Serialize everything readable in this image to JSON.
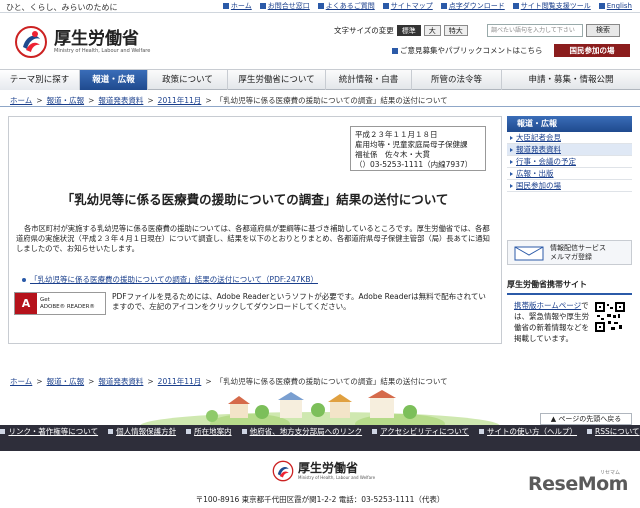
{
  "topbar": {
    "tagline": "ひと、くらし、みらいのために",
    "links": [
      "ホーム",
      "お問合せ窓口",
      "よくあるご質問",
      "サイトマップ",
      "点字ダウンロード",
      "サイト閲覧支援ツール",
      "English"
    ]
  },
  "header": {
    "logo_title": "厚生労働省",
    "logo_sub": "Ministry of Health, Labour and Welfare",
    "fontsize_label": "文字サイズの変更",
    "fontsize_options": [
      "標準",
      "大",
      "特大"
    ],
    "search_placeholder": "調べたい語句を入力して下さい",
    "search_button": "検索",
    "opinion_link": "ご意見募集やパブリックコメントはこちら",
    "kokumin_button": "国民参加の場"
  },
  "nav": {
    "items": [
      "テーマ別に探す",
      "報道・広報",
      "政策について",
      "厚生労働省について",
      "統計情報・白書",
      "所管の法令等",
      "申請・募集・情報公開"
    ]
  },
  "breadcrumb": {
    "items": [
      "ホーム",
      "報道・広報",
      "報道発表資料",
      "2011年11月"
    ],
    "current": "「乳幼児等に係る医療費の援助についての調査」結果の送付について"
  },
  "sender": {
    "lines": [
      "平成２３年１１月１８日",
      "雇用均等・児童家庭局母子保健課",
      "福祉係　佐々木・大貫",
      "（）03-5253-1111（内線7937）"
    ]
  },
  "article": {
    "title": "「乳幼児等に係る医療費の援助についての調査」結果の送付について",
    "body": "各市区町村が実施する乳幼児等に係る医療費の援助については、各都道府県が要綱等に基づき補助しているところです。厚生労働省では、各都道府県の実施状況（平成２３年４月１日現在）について調査し、結果を以下のとおりとりまとめ、各都道府県母子保健主管部（局）長あてに通知しましたので、お知らせいたします。",
    "pdf_link": "「乳幼児等に係る医療費の援助についての調査」結果の送付について（PDF:247KB）",
    "adobe_label_1": "Get",
    "adobe_label_2": "ADOBE® READER®",
    "adobe_note": "PDFファイルを見るためには、Adobe Readerというソフトが必要です。Adobe Readerは無料で配布されていますので、左記のアイコンをクリックしてダウンロードしてください。"
  },
  "sidebar": {
    "heading": "報道・広報",
    "items": [
      "大臣記者会見",
      "報道発表資料",
      "行事・会議の予定",
      "広報・出版",
      "国民参加の場"
    ],
    "mail_line1": "情報配信サービス",
    "mail_line2": "メルマガ登録",
    "mobile_title": "厚生労働省携帯サイト",
    "mobile_link": "携帯版ホームページ",
    "mobile_text": "では、緊急情報や厚生労働省の新着情報などを掲載しています。"
  },
  "pagetop": "ページの先頭へ戻る",
  "footer": {
    "links": [
      "リンク・著作権等について",
      "個人情報保護方針",
      "所在地案内",
      "他府省、地方支分部局へのリンク",
      "アクセシビリティについて",
      "サイトの使い方（ヘルプ）",
      "RSSについて"
    ],
    "logo_title": "厚生労働省",
    "logo_sub": "Ministry of Health, Labour and Welfare",
    "address": "〒100-8916 東京都千代田区霞が関1-2-2 電話：03-5253-1111（代表）"
  },
  "watermark": {
    "brand": "ReseMom",
    "sub": "リセマム"
  },
  "colors": {
    "accent": "#1f4a8e",
    "kokumin": "#8b1d1d",
    "footer": "#2e2e3a"
  }
}
